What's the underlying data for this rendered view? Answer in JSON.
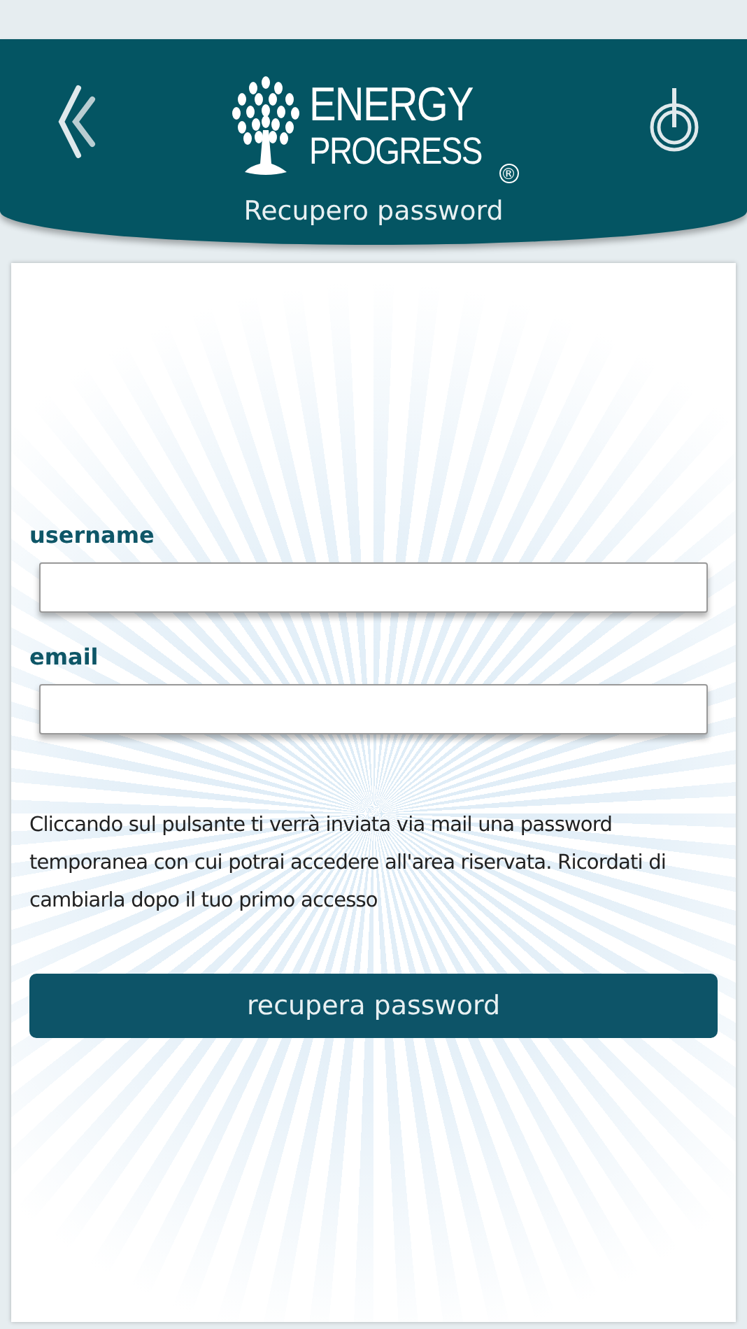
{
  "header": {
    "logo_line_1": "ENERGY",
    "logo_line_2": "PROGRESS",
    "logo_mark": "®",
    "title": "Recupero password"
  },
  "form": {
    "fields": [
      {
        "label": "username"
      },
      {
        "label": "email"
      }
    ],
    "note": "Cliccando sul pulsante ti verrà inviata via mail una password temporanea con cui potrai accedere all'area riservata. Ricordati di cambiarla dopo il tuo primo accesso",
    "button": "recupera password"
  }
}
